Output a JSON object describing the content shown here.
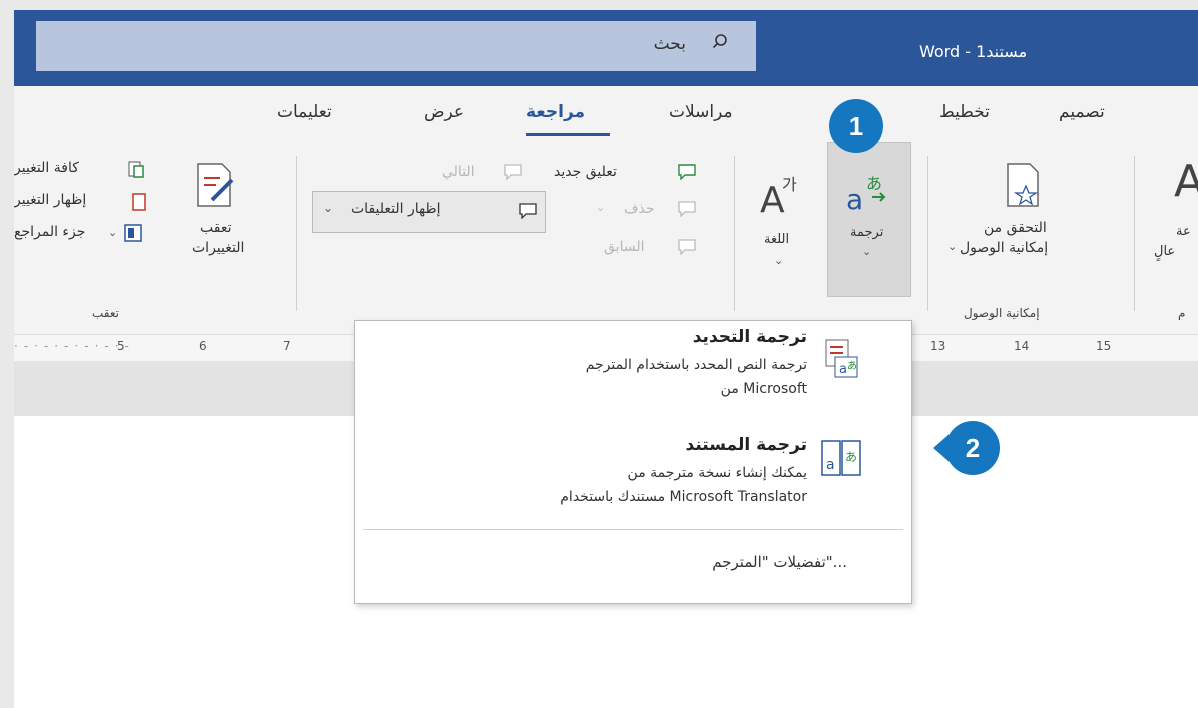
{
  "titlebar": {
    "search_label": "بحث",
    "doc_title": "Word - 1مستند"
  },
  "tabs": [
    {
      "label": "تعليمات"
    },
    {
      "label": "عرض"
    },
    {
      "label": "مراجعة"
    },
    {
      "label": "مراسلات"
    },
    {
      "label": "تخطيط"
    },
    {
      "label": "تصميم"
    }
  ],
  "ribbon": {
    "accept_all": "كافة التغيير",
    "show_changes": "إظهار التغيير",
    "review_pane": "جزء المراجع",
    "track_changes_line1": "تعقب",
    "track_changes_line2": "التغييرات",
    "tracking_group": "تعقب",
    "show_comments": "إظهار التعليقات",
    "new_comment": "تعليق جديد",
    "delete": "حذف",
    "previous": "السابق",
    "next": "التالي",
    "language": "اللغة",
    "translate": "ترجمة",
    "check_accessibility_line1": "التحقق من",
    "check_accessibility_line2": "إمكانية الوصول",
    "accessibility_group": "إمكانية الوصول",
    "edge_fragment_1": "عة",
    "edge_fragment_2": "عالٍ",
    "edge_fragment_3": "م"
  },
  "ruler": [
    "5",
    "6",
    "7",
    "13",
    "14",
    "15"
  ],
  "dropdown": {
    "translate_selection": {
      "title": "ترجمة التحديد",
      "desc_line1": "ترجمة النص المحدد باستخدام المترجم",
      "desc_line2": "من Microsoft"
    },
    "translate_document": {
      "title": "ترجمة المستند",
      "desc_line1": "يمكنك إنشاء نسخة مترجمة من",
      "desc_line2": "مستندك باستخدام Microsoft Translator"
    },
    "preferences": "تفضيلات \"المترجم\"..."
  },
  "callouts": {
    "one": "1",
    "two": "2"
  },
  "colors": {
    "title_bar": "#2b579a",
    "callout": "#1677c1"
  }
}
